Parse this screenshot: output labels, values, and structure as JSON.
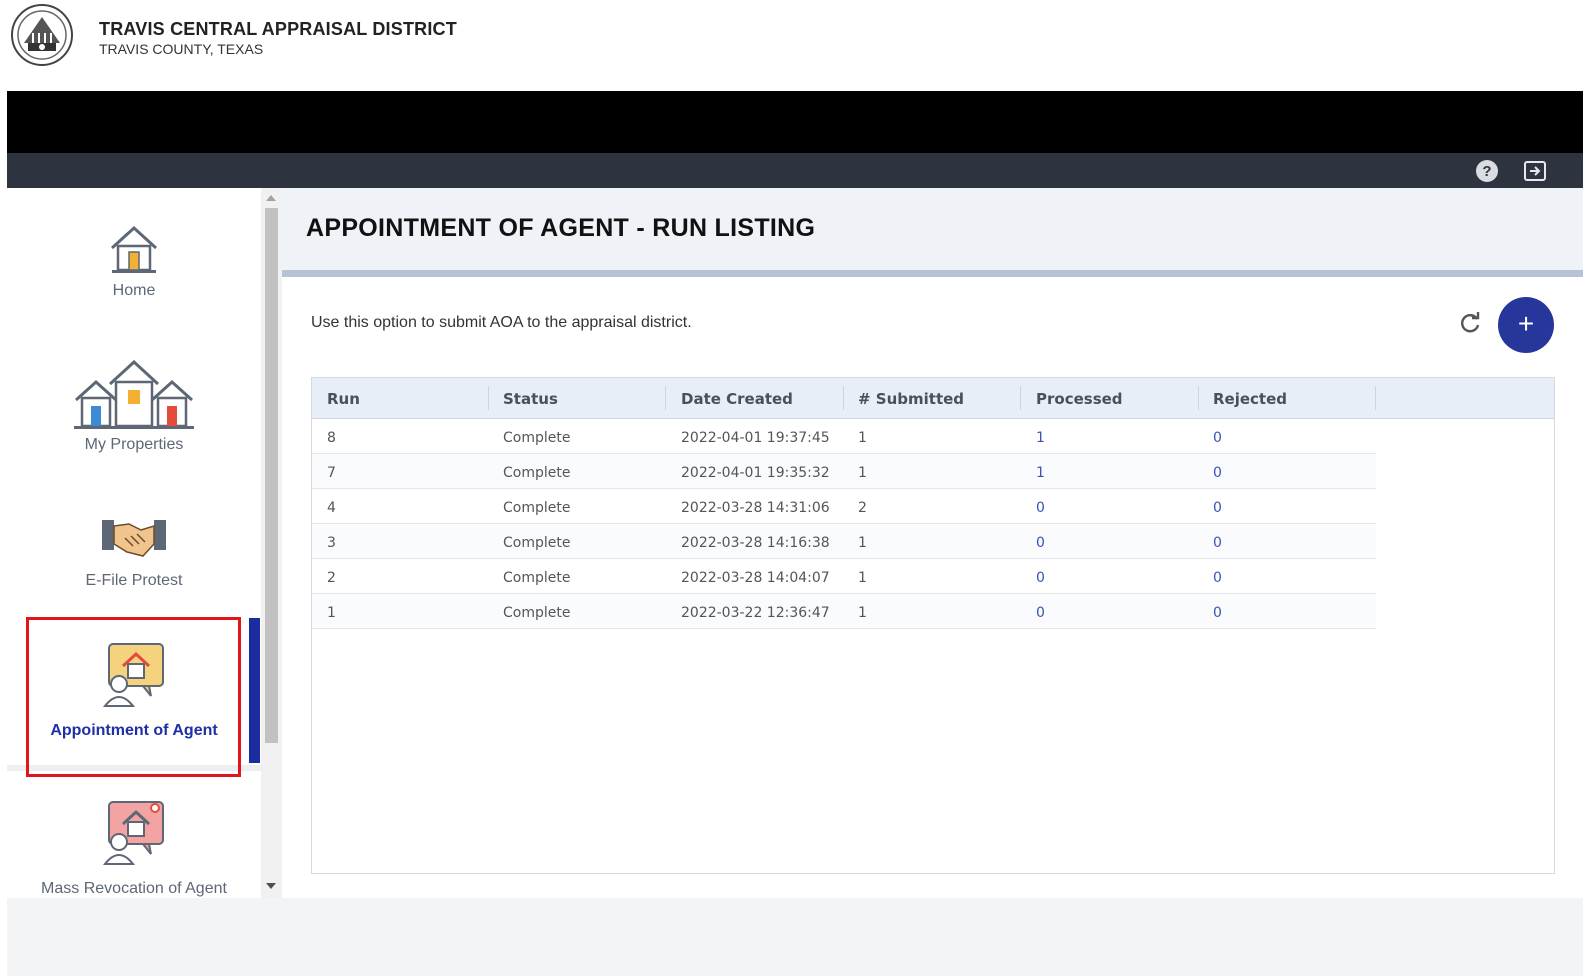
{
  "header": {
    "title": "TRAVIS CENTRAL APPRAISAL DISTRICT",
    "subtitle": "TRAVIS COUNTY, TEXAS"
  },
  "sidebar": {
    "items": [
      {
        "label": "Home",
        "icon": "home-icon"
      },
      {
        "label": "My Properties",
        "icon": "properties-icon"
      },
      {
        "label": "E-File Protest",
        "icon": "handshake-icon"
      },
      {
        "label": "Appointment of Agent",
        "icon": "agent-icon",
        "active": true
      },
      {
        "label": "Mass Revocation of Agent",
        "icon": "revocation-icon"
      }
    ]
  },
  "main": {
    "title": "APPOINTMENT OF AGENT - RUN LISTING",
    "description": "Use this option to submit AOA to the appraisal district.",
    "add_label": "+",
    "columns": [
      "Run",
      "Status",
      "Date Created",
      "# Submitted",
      "Processed",
      "Rejected"
    ],
    "rows": [
      [
        "8",
        "Complete",
        "2022-04-01 19:37:45",
        "1",
        "1",
        "0"
      ],
      [
        "7",
        "Complete",
        "2022-04-01 19:35:32",
        "1",
        "1",
        "0"
      ],
      [
        "4",
        "Complete",
        "2022-03-28 14:31:06",
        "2",
        "0",
        "0"
      ],
      [
        "3",
        "Complete",
        "2022-03-28 14:16:38",
        "1",
        "0",
        "0"
      ],
      [
        "2",
        "Complete",
        "2022-03-28 14:04:07",
        "1",
        "0",
        "0"
      ],
      [
        "1",
        "Complete",
        "2022-03-22 12:36:47",
        "1",
        "0",
        "0"
      ]
    ]
  },
  "colors": {
    "accent": "#27369b",
    "active_text": "#1f2fa6",
    "highlight_box": "#e2151b",
    "link": "#3a52b8"
  }
}
